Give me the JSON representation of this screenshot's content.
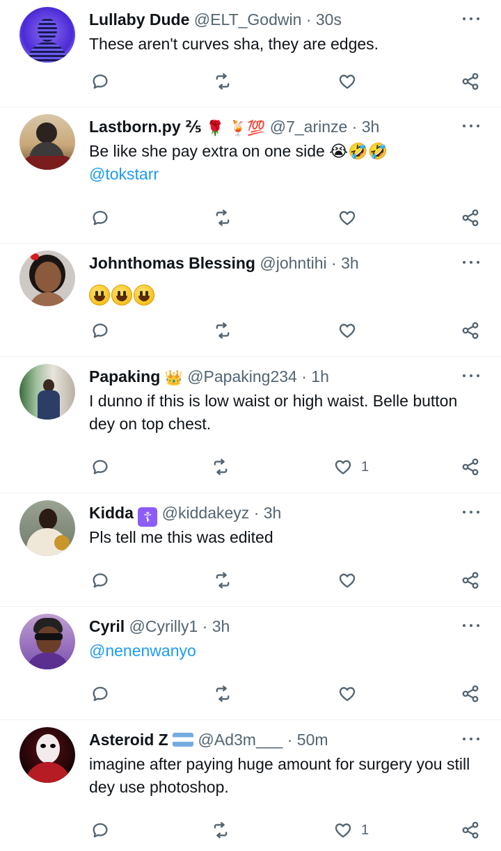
{
  "replies": [
    {
      "name": "Lullaby Dude",
      "badges": "",
      "handle": "@ELT_Godwin",
      "time": "30s",
      "text": "These aren't curves sha, they are edges.",
      "mention": "",
      "like_count": ""
    },
    {
      "name": "Lastborn.py ⅖",
      "badges": "🌹 🍹💯",
      "handle": "@7_arinze",
      "time": "3h",
      "text": "Be like she pay extra on one side 😭🤣🤣",
      "mention": "@tokstarr",
      "like_count": ""
    },
    {
      "name": "Johnthomas Blessing",
      "badges": "",
      "handle": "@johntihi",
      "time": "3h",
      "text": "",
      "mention": "",
      "like_count": ""
    },
    {
      "name": "Papaking",
      "badges": "👑",
      "handle": "@Papaking234",
      "time": "1h",
      "text": "I dunno if this is low waist or high waist. Belle button dey on top chest.",
      "mention": "",
      "like_count": "1"
    },
    {
      "name": "Kidda",
      "badges": "☦",
      "handle": "@kiddakeyz",
      "time": "3h",
      "text": "Pls tell me this was edited",
      "mention": "",
      "like_count": ""
    },
    {
      "name": "Cyril",
      "badges": "",
      "handle": "@Cyrilly1",
      "time": "3h",
      "text": "",
      "mention": "@nenenwanyo",
      "like_count": ""
    },
    {
      "name": "Asteroid Z",
      "badges": "🇦🇷",
      "handle": "@Ad3m___",
      "time": "50m",
      "text": "imagine after paying huge amount for surgery you still dey use photoshop.",
      "mention": "",
      "like_count": "1"
    }
  ],
  "separator": "·",
  "icons": {
    "reply": "reply-icon",
    "retweet": "retweet-icon",
    "like": "heart-icon",
    "share": "share-icon",
    "more": "more-icon"
  },
  "colors": {
    "text": "#0f1419",
    "muted": "#536471",
    "link": "#1d9bf0",
    "divider": "#eff3f4"
  }
}
